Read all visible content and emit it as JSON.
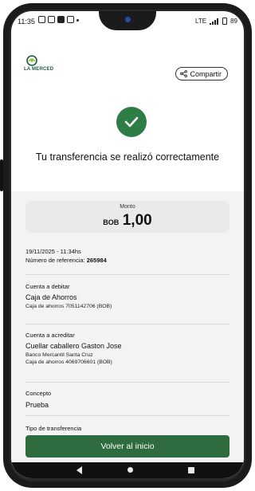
{
  "status_bar": {
    "time": "11:35",
    "network": "LTE",
    "battery": "89"
  },
  "header": {
    "logo_text": "LA MERCED",
    "share_label": "Compartir"
  },
  "success": {
    "title": "Tu transferencia se realizó correctamente"
  },
  "amount": {
    "label": "Monto",
    "currency": "BOB",
    "value": "1,00"
  },
  "details": {
    "datetime": "19/11/2025 - 11:34hs",
    "reference_label": "Número de referencia:",
    "reference_value": "265984",
    "debit": {
      "label": "Cuenta a debitar",
      "name": "Caja de Ahorros",
      "detail": "Caja de ahorros 7051142706 (BOB)"
    },
    "credit": {
      "label": "Cuenta a acreditar",
      "name": "Cuellar caballero Gaston Jose",
      "bank": "Banco Mercantil Santa Cruz",
      "detail": "Caja de ahorros 4069706601 (BOB)"
    },
    "concept": {
      "label": "Concepto",
      "value": "Prueba"
    },
    "transfer_type": {
      "label": "Tipo de transferencia"
    }
  },
  "actions": {
    "back_home": "Volver al inicio"
  },
  "colors": {
    "brand_green": "#2e7d46",
    "button_green": "#2e6b3f"
  }
}
